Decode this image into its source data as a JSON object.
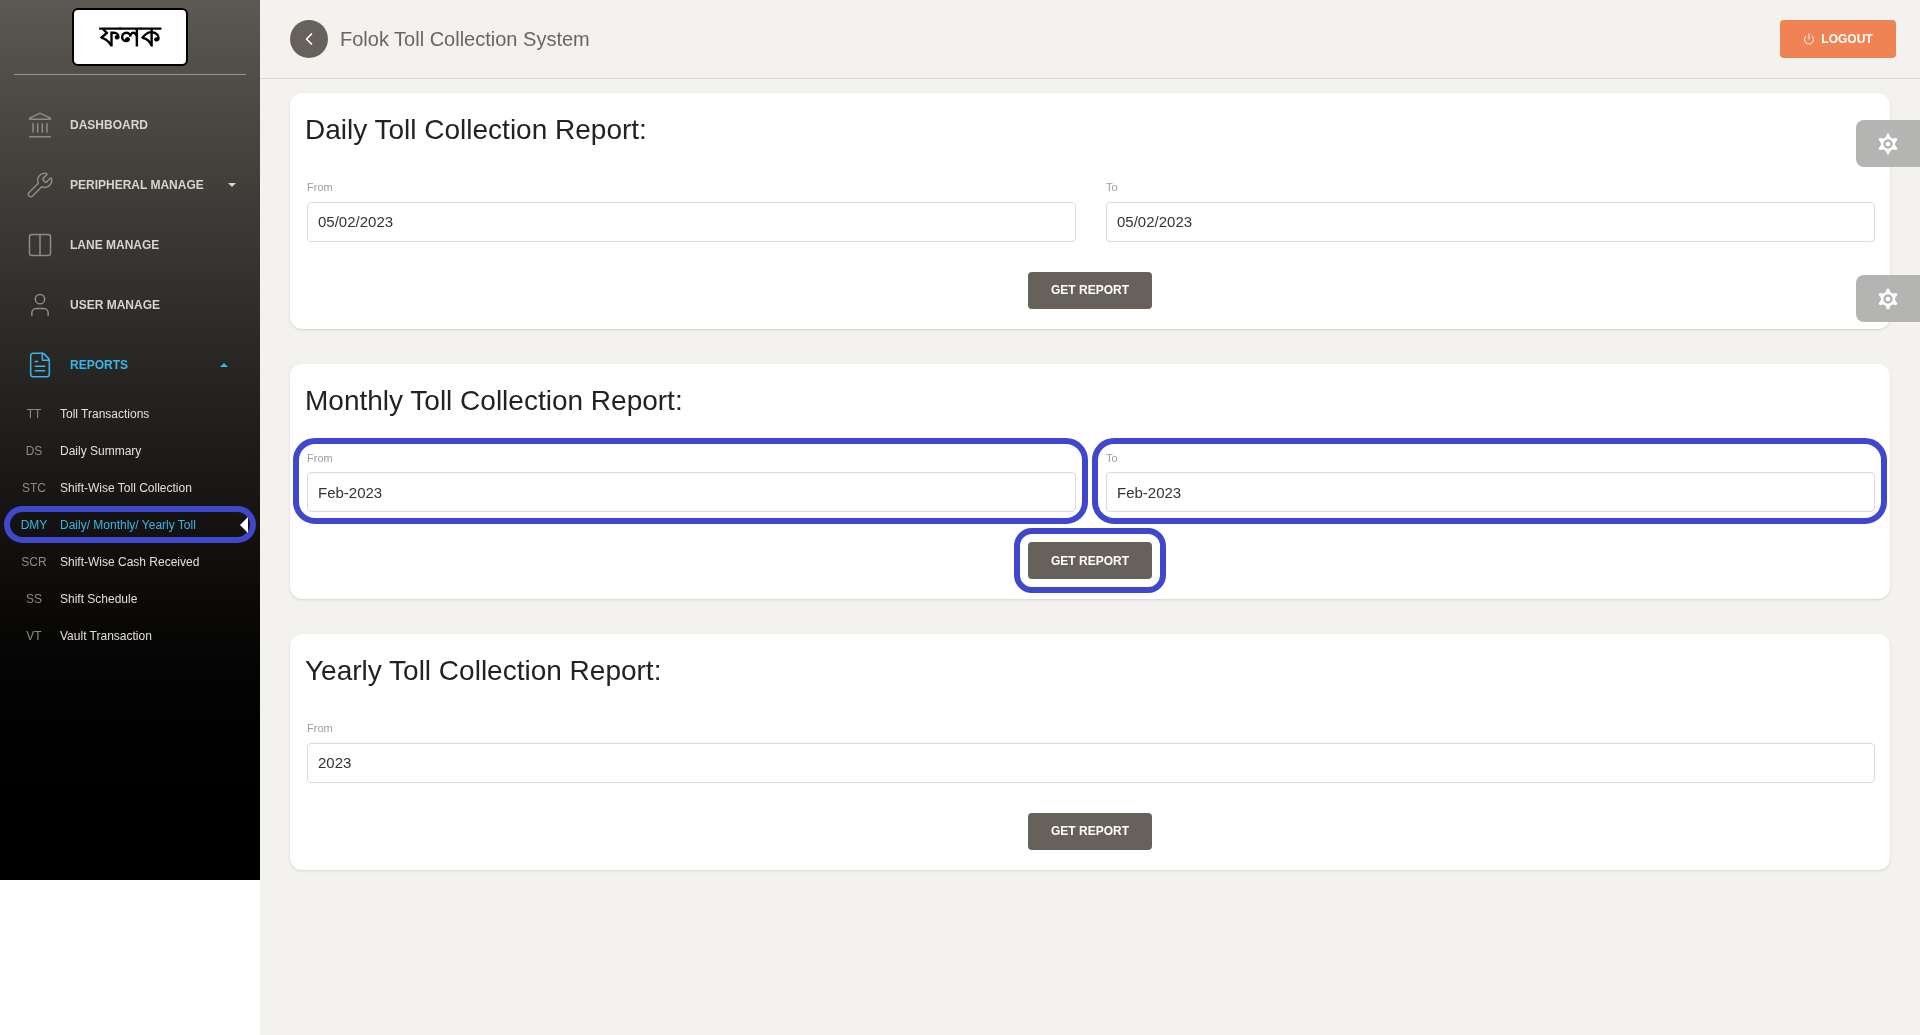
{
  "sidebar": {
    "logo": "ফলক",
    "items": [
      {
        "label": "DASHBOARD",
        "selected": false
      },
      {
        "label": "PERIPHERAL MANAGE",
        "selected": false,
        "expanded": false
      },
      {
        "label": "LANE MANAGE",
        "selected": false
      },
      {
        "label": "USER MANAGE",
        "selected": false
      },
      {
        "label": "REPORTS",
        "selected": true,
        "expanded": true,
        "children": [
          {
            "abbr": "TT",
            "label": "Toll Transactions",
            "selected": false,
            "highlighted": false
          },
          {
            "abbr": "DS",
            "label": "Daily Summary",
            "selected": false,
            "highlighted": false
          },
          {
            "abbr": "STC",
            "label": "Shift-Wise Toll Collection",
            "selected": false,
            "highlighted": false
          },
          {
            "abbr": "DMY",
            "label": "Daily/ Monthly/ Yearly Toll",
            "selected": true,
            "highlighted": true
          },
          {
            "abbr": "SCR",
            "label": "Shift-Wise Cash Received",
            "selected": false,
            "highlighted": false
          },
          {
            "abbr": "SS",
            "label": "Shift Schedule",
            "selected": false,
            "highlighted": false
          },
          {
            "abbr": "VT",
            "label": "Vault Transaction",
            "selected": false,
            "highlighted": false
          }
        ]
      }
    ]
  },
  "header": {
    "title": "Folok Toll Collection System",
    "logout": "LOGOUT"
  },
  "reports": [
    {
      "title": "Daily Toll Collection Report:",
      "fields": [
        {
          "label": "From",
          "value": "05/02/2023",
          "highlighted": false
        },
        {
          "label": "To",
          "value": "05/02/2023",
          "highlighted": false
        }
      ],
      "button": {
        "label": "GET REPORT",
        "highlighted": false
      }
    },
    {
      "title": "Monthly Toll Collection Report:",
      "fields": [
        {
          "label": "From",
          "value": "Feb-2023",
          "highlighted": true
        },
        {
          "label": "To",
          "value": "Feb-2023",
          "highlighted": true
        }
      ],
      "button": {
        "label": "GET REPORT",
        "highlighted": true
      }
    },
    {
      "title": "Yearly Toll Collection Report:",
      "fields": [
        {
          "label": "From",
          "value": "2023",
          "highlighted": false
        }
      ],
      "button": {
        "label": "GET REPORT",
        "highlighted": false
      }
    }
  ]
}
